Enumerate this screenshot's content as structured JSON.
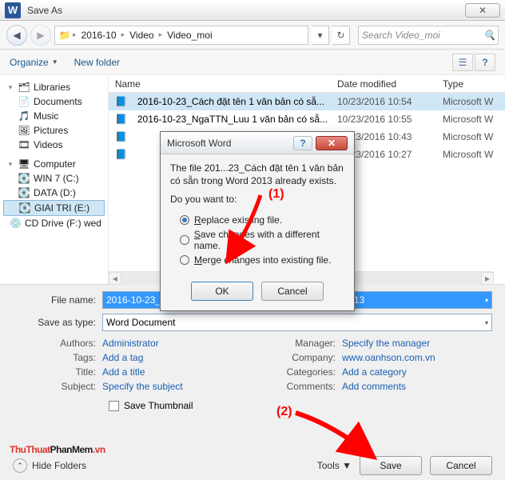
{
  "window": {
    "title": "Save As",
    "close_glyph": "✕"
  },
  "nav": {
    "breadcrumb": [
      "2016-10",
      "Video",
      "Video_moi"
    ],
    "search_placeholder": "Search Video_moi"
  },
  "toolbar": {
    "organize": "Organize",
    "new_folder": "New folder"
  },
  "tree": {
    "libraries": {
      "label": "Libraries",
      "items": [
        "Documents",
        "Music",
        "Pictures",
        "Videos"
      ]
    },
    "computer": {
      "label": "Computer",
      "items": [
        "WIN 7 (C:)",
        "DATA (D:)",
        "GIAI TRI (E:)",
        "CD Drive (F:) wed"
      ]
    }
  },
  "files": {
    "headers": {
      "name": "Name",
      "date": "Date modified",
      "type": "Type"
    },
    "rows": [
      {
        "name": "2016-10-23_Cách đặt tên 1 văn bản có sẵ...",
        "date": "10/23/2016 10:54",
        "type": "Microsoft W",
        "selected": true
      },
      {
        "name": "2016-10-23_NgaTTN_Luu 1 văn bản có sẵ...",
        "date": "10/23/2016 10:55",
        "type": "Microsoft W"
      },
      {
        "name": "",
        "date": "10/23/2016 10:43",
        "type": "Microsoft W"
      },
      {
        "name": "",
        "date": "10/23/2016 10:27",
        "type": "Microsoft W"
      }
    ]
  },
  "form": {
    "filename_label": "File name:",
    "filename_value": "2016-10-23_Cách đặt tên 1 văn bản có sẵn trong Word 2013",
    "type_label": "Save as type:",
    "type_value": "Word Document",
    "meta": {
      "authors_label": "Authors:",
      "authors_value": "Administrator",
      "tags_label": "Tags:",
      "tags_value": "Add a tag",
      "title_label": "Title:",
      "title_value": "Add a title",
      "subject_label": "Subject:",
      "subject_value": "Specify the subject",
      "manager_label": "Manager:",
      "manager_value": "Specify the manager",
      "company_label": "Company:",
      "company_value": "www.oanhson.com.vn",
      "categories_label": "Categories:",
      "categories_value": "Add a category",
      "comments_label": "Comments:",
      "comments_value": "Add comments"
    },
    "save_thumbnail": "Save Thumbnail"
  },
  "footer": {
    "hide_folders": "Hide Folders",
    "tools": "Tools",
    "save": "Save",
    "cancel": "Cancel"
  },
  "modal": {
    "title": "Microsoft Word",
    "message1": "The file 201...23_Cách đặt tên 1 văn bản có sẵn trong Word 2013 already exists.",
    "prompt": "Do you want to:",
    "opt1_a": "R",
    "opt1_b": "eplace existing file.",
    "opt2_a": "S",
    "opt2_b": "ave changes with a different name.",
    "opt3_a": "M",
    "opt3_b": "erge changes into existing file.",
    "ok": "OK",
    "cancel": "Cancel"
  },
  "watermark": {
    "part1": "ThuThuat",
    "part2": "PhanMem",
    "part3": ".vn"
  },
  "anno": {
    "n1": "(1)",
    "n2": "(2)"
  }
}
